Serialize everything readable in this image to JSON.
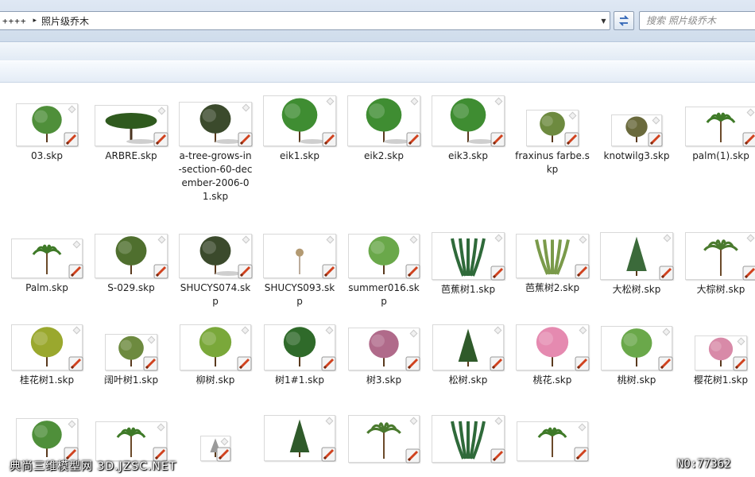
{
  "address_bar": {
    "prefix": "++++",
    "separator": "▸",
    "current_folder": "照片级乔木",
    "dropdown": "▼"
  },
  "search": {
    "placeholder": "搜索 照片级乔木"
  },
  "files": [
    {
      "name": "03.skp",
      "plant": "bush"
    },
    {
      "name": "ARBRE.skp",
      "plant": "umbrella"
    },
    {
      "name": "a-tree-grows-in-section-60-december-2006-01.skp",
      "plant": "dark"
    },
    {
      "name": "eik1.skp",
      "plant": "oak"
    },
    {
      "name": "eik2.skp",
      "plant": "oak"
    },
    {
      "name": "eik3.skp",
      "plant": "oak"
    },
    {
      "name": "fraxinus farbe.skp",
      "plant": "sparse"
    },
    {
      "name": "knotwilg3.skp",
      "plant": "pollard"
    },
    {
      "name": "palm(1).skp",
      "plant": "palm"
    },
    {
      "name": "Palm.skp",
      "plant": "palm"
    },
    {
      "name": "S-029.skp",
      "plant": "spread"
    },
    {
      "name": "SHUCYS074.skp",
      "plant": "dark"
    },
    {
      "name": "SHUCYS093.skp",
      "plant": "tiny"
    },
    {
      "name": "summer016.skp",
      "plant": "light"
    },
    {
      "name": "芭蕉树1.skp",
      "plant": "banana"
    },
    {
      "name": "芭蕉树2.skp",
      "plant": "bamboo"
    },
    {
      "name": "大松树.skp",
      "plant": "pine-big"
    },
    {
      "name": "大棕树.skp",
      "plant": "palm-tall"
    },
    {
      "name": "桂花树1.skp",
      "plant": "yellow"
    },
    {
      "name": "阔叶树1.skp",
      "plant": "sparse"
    },
    {
      "name": "柳树.skp",
      "plant": "willow"
    },
    {
      "name": "树1#1.skp",
      "plant": "round"
    },
    {
      "name": "树3.skp",
      "plant": "pinkish"
    },
    {
      "name": "松树.skp",
      "plant": "cone"
    },
    {
      "name": "桃花.skp",
      "plant": "pink"
    },
    {
      "name": "桃树.skp",
      "plant": "light"
    },
    {
      "name": "樱花树1.skp",
      "plant": "pink-sparse"
    },
    {
      "name": "",
      "plant": "bush"
    },
    {
      "name": "",
      "plant": "palm"
    },
    {
      "name": "",
      "plant": "winter"
    },
    {
      "name": "",
      "plant": "cone"
    },
    {
      "name": "",
      "plant": "palm-tall"
    },
    {
      "name": "",
      "plant": "banana"
    },
    {
      "name": "",
      "plant": "palm"
    }
  ],
  "watermark": {
    "left": "典尚三维模型网 3D.JZSC.NET",
    "right": "NO:77362"
  }
}
